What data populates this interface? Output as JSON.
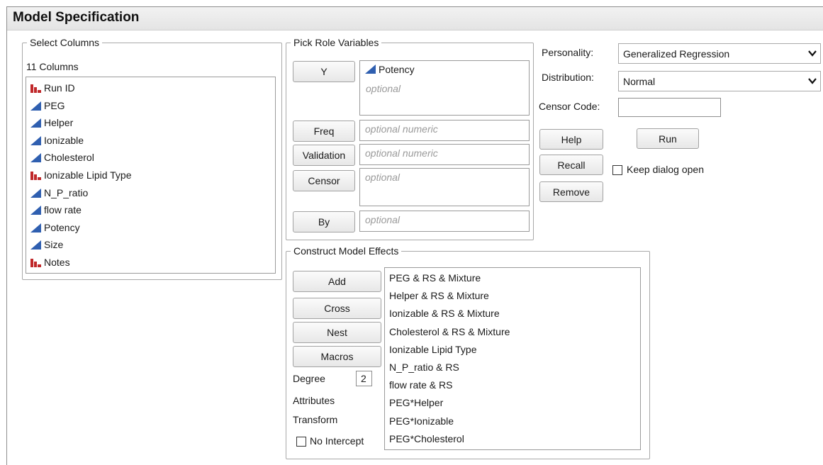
{
  "title": "Model Specification",
  "select_columns": {
    "legend": "Select Columns",
    "count_label": "11 Columns",
    "columns": [
      {
        "name": "Run ID",
        "type": "nominal"
      },
      {
        "name": "PEG",
        "type": "continuous"
      },
      {
        "name": "Helper",
        "type": "continuous"
      },
      {
        "name": "Ionizable",
        "type": "continuous"
      },
      {
        "name": "Cholesterol",
        "type": "continuous"
      },
      {
        "name": "Ionizable Lipid Type",
        "type": "nominal"
      },
      {
        "name": "N_P_ratio",
        "type": "continuous"
      },
      {
        "name": "flow rate",
        "type": "continuous"
      },
      {
        "name": "Potency",
        "type": "continuous"
      },
      {
        "name": "Size",
        "type": "continuous"
      },
      {
        "name": "Notes",
        "type": "nominal"
      }
    ]
  },
  "roles": {
    "legend": "Pick Role Variables",
    "y": {
      "button": "Y",
      "value": "Potency",
      "placeholder": "optional"
    },
    "freq": {
      "button": "Freq",
      "placeholder": "optional numeric"
    },
    "validation": {
      "button": "Validation",
      "placeholder": "optional numeric"
    },
    "censor": {
      "button": "Censor",
      "placeholder": "optional"
    },
    "by": {
      "button": "By",
      "placeholder": "optional"
    }
  },
  "settings": {
    "personality_label": "Personality:",
    "personality_value": "Generalized Regression",
    "distribution_label": "Distribution:",
    "distribution_value": "Normal",
    "censor_code_label": "Censor Code:",
    "censor_code_value": ""
  },
  "actions": {
    "help": "Help",
    "run": "Run",
    "recall": "Recall",
    "remove": "Remove",
    "keep_dialog_open": "Keep dialog open",
    "keep_dialog_open_checked": false
  },
  "effects": {
    "legend": "Construct Model Effects",
    "add": "Add",
    "cross": "Cross",
    "nest": "Nest",
    "macros": "Macros",
    "degree_label": "Degree",
    "degree_value": "2",
    "attributes": "Attributes",
    "transform": "Transform",
    "no_intercept": "No Intercept",
    "no_intercept_checked": false,
    "items": [
      "PEG & RS & Mixture",
      "Helper & RS & Mixture",
      "Ionizable & RS & Mixture",
      "Cholesterol & RS & Mixture",
      "Ionizable Lipid Type",
      "N_P_ratio & RS",
      "flow rate & RS",
      "PEG*Helper",
      "PEG*Ionizable",
      "PEG*Cholesterol"
    ]
  },
  "icons": {
    "nominal": "nominal-bar-icon",
    "continuous": "continuous-triangle-icon"
  },
  "colors": {
    "nominal_icon": "#c0282a",
    "continuous_icon": "#2f5fb0"
  }
}
